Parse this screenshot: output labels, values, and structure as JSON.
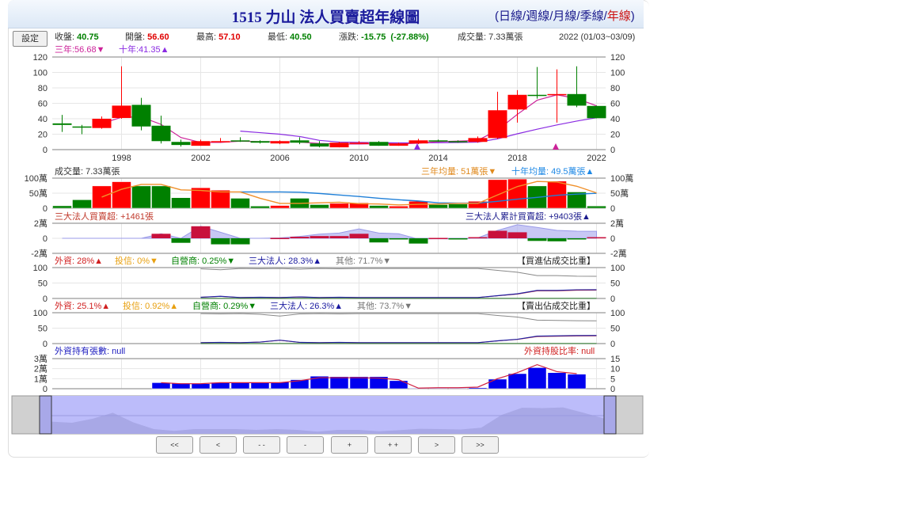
{
  "header": {
    "title": "1515 力山 法人買賣超年線圖",
    "links": [
      "日線",
      "週線",
      "月線",
      "季線",
      "年線"
    ],
    "active_link": "年線"
  },
  "info": {
    "settings_label": "設定",
    "close_label": "收盤:",
    "close": "40.75",
    "open_label": "開盤:",
    "open": "56.60",
    "high_label": "最高:",
    "high": "57.10",
    "low_label": "最低:",
    "low": "40.50",
    "change_label": "漲跌:",
    "change": "-15.75  (-27.88%)",
    "volume_label": "成交量:",
    "volume": "7.33萬張",
    "period": "2022 (01/03~03/09)"
  },
  "legends": {
    "ma3": "三年:56.68▼",
    "ma10": "十年:41.35▲",
    "vol": "成交量: 7.33萬張",
    "vol_ma3": "三年均量: 51萬張▼",
    "vol_ma10": "十年均量: 49.5萬張▲",
    "net": "三大法人買賣超: +1461張",
    "net_cum": "三大法人累計買賣超: +9403張▲",
    "buy": {
      "foreign": "外資: 28%▲",
      "trust": "投信: 0%▼",
      "dealer": "自營商: 0.25%▼",
      "inst": "三大法人: 28.3%▲",
      "other": "其他: 71.7%▼",
      "title": "【買進佔成交比重】"
    },
    "sell": {
      "foreign": "外資: 25.1%▲",
      "trust": "投信: 0.92%▲",
      "dealer": "自營商: 0.29%▼",
      "inst": "三大法人: 26.3%▲",
      "other": "其他: 73.7%▼",
      "title": "【賣出佔成交比重】"
    },
    "hold": "外資持有張數: null",
    "hold_ratio": "外資持股比率: null"
  },
  "nav_buttons": [
    "<<",
    "<",
    "- -",
    "-",
    "+",
    "+ +",
    ">",
    ">>"
  ],
  "colors": {
    "up": "#ff0000",
    "down": "#008000",
    "ma3": "#cc2299",
    "ma10": "#8a2be2",
    "vma3": "#f0902a",
    "vma10": "#2080d8",
    "net_up": "#c8103c",
    "cum": "#b0b0f0",
    "hold": "#0000ee",
    "hold_ratio": "#d02040"
  },
  "chart_data": {
    "type": "candlestick",
    "years": [
      1995,
      1996,
      1997,
      1998,
      1999,
      2000,
      2001,
      2002,
      2003,
      2004,
      2005,
      2006,
      2007,
      2008,
      2009,
      2010,
      2011,
      2012,
      2013,
      2014,
      2015,
      2016,
      2017,
      2018,
      2019,
      2020,
      2021,
      2022
    ],
    "x_ticks": [
      "1998",
      "2002",
      "2006",
      "2010",
      "2014",
      "2018",
      "2022"
    ],
    "price": {
      "ylim": [
        0,
        120
      ],
      "ticks": [
        0,
        20,
        40,
        60,
        80,
        100,
        120
      ],
      "open": [
        34,
        30,
        28,
        41,
        58,
        31,
        10,
        5,
        10,
        12,
        11,
        8,
        12,
        8,
        3,
        9,
        10,
        5,
        8,
        12,
        11,
        10,
        15,
        52,
        71,
        71,
        72,
        56.6
      ],
      "high": [
        45,
        32,
        43,
        108,
        67,
        44,
        13,
        13,
        15,
        16,
        12,
        12,
        16,
        11,
        10,
        11,
        11,
        9,
        14,
        13,
        12,
        17,
        75,
        77,
        107,
        104,
        108,
        57.1
      ],
      "low": [
        23,
        20,
        27,
        40,
        25,
        8,
        4,
        5,
        9,
        10,
        8,
        7,
        7,
        3,
        3,
        8,
        5,
        5,
        7,
        10,
        9,
        9,
        14,
        35,
        66,
        35,
        55,
        40.5
      ],
      "close": [
        32,
        29,
        40,
        57,
        30,
        11,
        6,
        11,
        11,
        11,
        9,
        11,
        9,
        4,
        9,
        9,
        5,
        8,
        12,
        11,
        10,
        15,
        51,
        71,
        70,
        72,
        57,
        40.75
      ],
      "ma3": [
        null,
        null,
        33.7,
        42,
        42.3,
        32.7,
        15.7,
        9.3,
        9.3,
        11,
        10.3,
        10.3,
        9.7,
        8,
        7.3,
        7.3,
        7.7,
        7.3,
        8.3,
        10.3,
        11,
        12,
        25.3,
        45.7,
        64,
        71,
        66.3,
        56.68
      ],
      "ma10": [
        null,
        null,
        null,
        null,
        null,
        null,
        null,
        null,
        null,
        24,
        22,
        20,
        17,
        12,
        9.8,
        9.4,
        9,
        8.7,
        8.8,
        9,
        9.2,
        9.7,
        14,
        20.5,
        26.5,
        32,
        37,
        41.35
      ]
    },
    "volume": {
      "ylim": [
        0,
        100
      ],
      "ticks": [
        "0",
        "50萬",
        "100萬"
      ],
      "values": [
        8,
        28,
        74,
        88,
        74,
        74,
        35,
        68,
        60,
        33,
        7,
        9,
        33,
        12,
        16,
        18,
        9,
        7,
        23,
        12,
        14,
        23,
        95,
        97,
        74,
        90,
        54,
        7.33
      ],
      "ma3": [
        null,
        null,
        37,
        63,
        79,
        79,
        61,
        59,
        54,
        54,
        33,
        16,
        16,
        18,
        20,
        15,
        14,
        11,
        13,
        14,
        16,
        16,
        44,
        72,
        89,
        87,
        73,
        51
      ],
      "ma10": [
        null,
        null,
        null,
        null,
        null,
        null,
        null,
        null,
        null,
        54,
        54,
        54,
        53,
        49,
        44,
        39,
        33,
        28,
        24,
        18,
        17,
        17,
        23,
        30,
        36,
        43,
        47,
        49.5
      ]
    },
    "net": {
      "ylim": [
        -2,
        2
      ],
      "ticks": [
        "-2萬",
        "0",
        "2萬"
      ],
      "values": [
        0,
        0,
        0,
        0,
        0,
        0.6,
        -0.6,
        1.6,
        -0.8,
        -0.8,
        0,
        0.05,
        0.2,
        0.3,
        0.3,
        0.6,
        -0.55,
        -0.1,
        -0.7,
        0.05,
        -0.05,
        0.15,
        1.0,
        0.8,
        -0.35,
        -0.4,
        -0.1,
        0.15
      ],
      "cumulative": [
        0,
        0,
        0,
        0,
        0,
        0.6,
        0,
        1.6,
        0.8,
        0,
        0,
        0.05,
        0.25,
        0.55,
        0.7,
        1.25,
        0.7,
        0.6,
        -0.1,
        -0.05,
        -0.1,
        0.05,
        1.05,
        1.8,
        1.45,
        1.05,
        0.95,
        0.94
      ]
    },
    "buy_ratio": {
      "ylim": [
        0,
        100
      ],
      "ticks": [
        "0",
        "50",
        "100"
      ],
      "other": [
        null,
        null,
        null,
        null,
        null,
        null,
        null,
        96,
        93,
        97,
        96,
        97,
        95,
        97,
        96,
        97,
        97,
        97,
        97,
        97,
        97,
        97,
        91,
        85,
        74,
        74,
        72,
        71.7
      ],
      "inst": [
        null,
        null,
        null,
        null,
        null,
        null,
        null,
        4,
        7,
        3,
        4,
        3,
        5,
        3,
        4,
        3,
        3,
        3,
        3,
        3,
        3,
        3,
        9,
        15,
        26,
        26,
        28,
        28.3
      ]
    },
    "sell_ratio": {
      "ylim": [
        0,
        100
      ],
      "ticks": [
        "0",
        "50",
        "100"
      ],
      "other": [
        null,
        null,
        null,
        null,
        null,
        null,
        null,
        97,
        96,
        97,
        95,
        89,
        96,
        97,
        96,
        97,
        97,
        97,
        97,
        97,
        97,
        97,
        91,
        86,
        76,
        75,
        74,
        73.7
      ],
      "inst": [
        null,
        null,
        null,
        null,
        null,
        null,
        null,
        3,
        4,
        3,
        5,
        11,
        4,
        3,
        4,
        3,
        3,
        3,
        3,
        3,
        3,
        3,
        9,
        14,
        24,
        25,
        26,
        26.3
      ]
    },
    "holdings": {
      "ylim": [
        0,
        3
      ],
      "ticks": [
        "0",
        "1萬",
        "2萬",
        "3萬"
      ],
      "ratio_ylim": [
        0,
        15
      ],
      "ratio_ticks": [
        "0",
        "5",
        "10",
        "15"
      ],
      "values": [
        null,
        null,
        null,
        null,
        null,
        0.6,
        0.55,
        0.5,
        0.6,
        0.6,
        0.6,
        0.65,
        0.9,
        1.25,
        1.2,
        1.2,
        1.2,
        0.8,
        0.05,
        0.05,
        0.05,
        0.1,
        0.95,
        1.5,
        2.1,
        1.6,
        1.45,
        null
      ],
      "ratio": [
        null,
        null,
        null,
        null,
        null,
        3,
        2.5,
        2.5,
        3,
        3,
        3,
        3,
        4,
        5.5,
        5.5,
        5.5,
        5.3,
        4.5,
        0.3,
        0.5,
        0.5,
        0.8,
        5,
        8,
        12,
        8.5,
        7.5,
        null
      ]
    }
  }
}
